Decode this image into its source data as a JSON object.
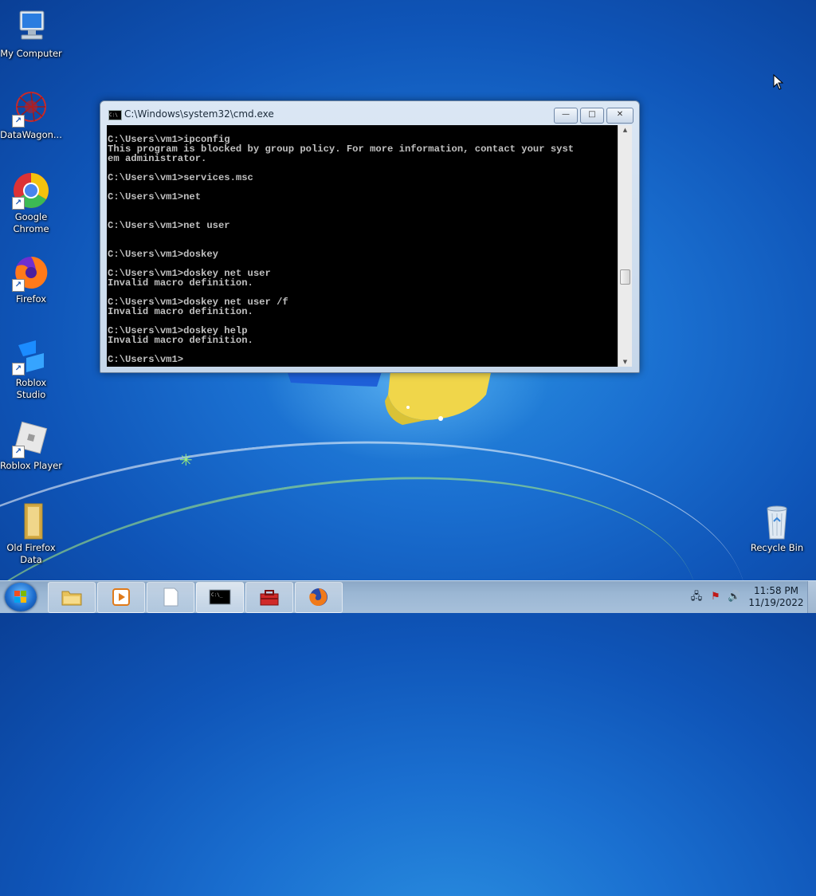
{
  "desktop": {
    "icons": [
      {
        "label": "My Computer"
      },
      {
        "label": "DataWagon..."
      },
      {
        "label": "Google Chrome"
      },
      {
        "label": "Firefox"
      },
      {
        "label": "Roblox Studio"
      },
      {
        "label": "Roblox Player"
      },
      {
        "label": "Old Firefox Data"
      },
      {
        "label": "Recycle Bin"
      }
    ]
  },
  "cmd_window": {
    "title": "C:\\Windows\\system32\\cmd.exe",
    "buttons": {
      "minimize": "—",
      "maximize": "□",
      "close": "✕"
    },
    "output": "C:\\Users\\vm1>ipconfig\nThis program is blocked by group policy. For more information, contact your syst\nem administrator.\n\nC:\\Users\\vm1>services.msc\n\nC:\\Users\\vm1>net\n\n\nC:\\Users\\vm1>net user\n\n\nC:\\Users\\vm1>doskey\n\nC:\\Users\\vm1>doskey net user\nInvalid macro definition.\n\nC:\\Users\\vm1>doskey net user /f\nInvalid macro definition.\n\nC:\\Users\\vm1>doskey help\nInvalid macro definition.\n\nC:\\Users\\vm1>"
  },
  "taskbar": {
    "pinned": [
      {
        "icon": "folder-icon"
      },
      {
        "icon": "media-player-icon"
      },
      {
        "icon": "document-icon"
      },
      {
        "icon": "cmd-icon"
      },
      {
        "icon": "toolbox-icon"
      },
      {
        "icon": "firefox-icon"
      }
    ],
    "tray": {
      "time": "11:58 PM",
      "date": "11/19/2022"
    }
  },
  "colors": {
    "desktop_blue": "#1a6fd0",
    "console_bg": "#000000",
    "console_text": "#c0c0c0"
  }
}
